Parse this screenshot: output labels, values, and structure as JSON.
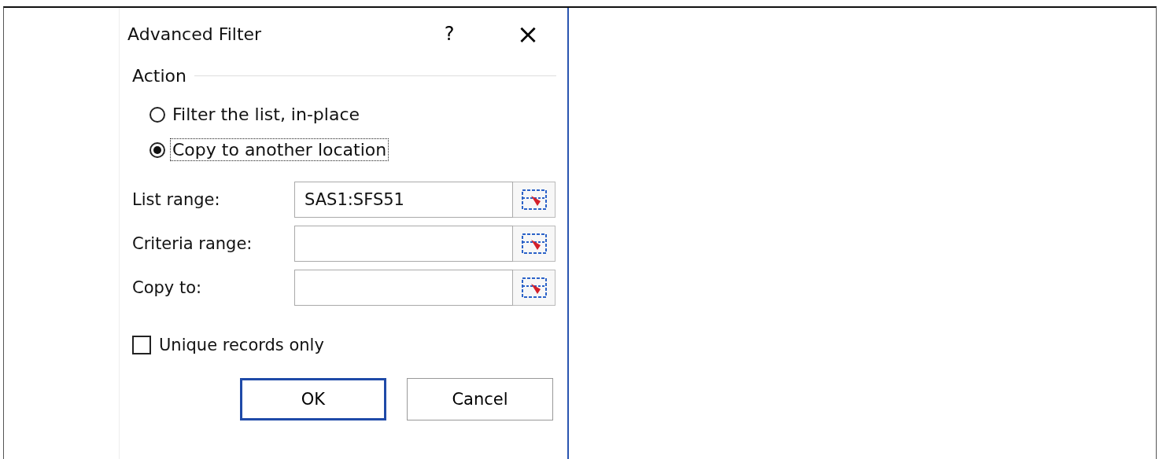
{
  "dialog": {
    "title": "Advanced Filter",
    "help": "?",
    "close": "×"
  },
  "action": {
    "label": "Action",
    "options": [
      {
        "label": "Filter the list, in-place",
        "selected": false,
        "focused": false
      },
      {
        "label": "Copy to another location",
        "selected": true,
        "focused": true
      }
    ]
  },
  "fields": [
    {
      "label": "List range:",
      "value": "SAS1:SFS51"
    },
    {
      "label": "Criteria range:"
    },
    {
      "label": "Copy to:"
    }
  ],
  "unique": {
    "label": "Unique records only",
    "checked": false
  },
  "buttons": [
    {
      "label": "OK",
      "default": true
    },
    {
      "label": "Cancel",
      "default": false
    }
  ]
}
